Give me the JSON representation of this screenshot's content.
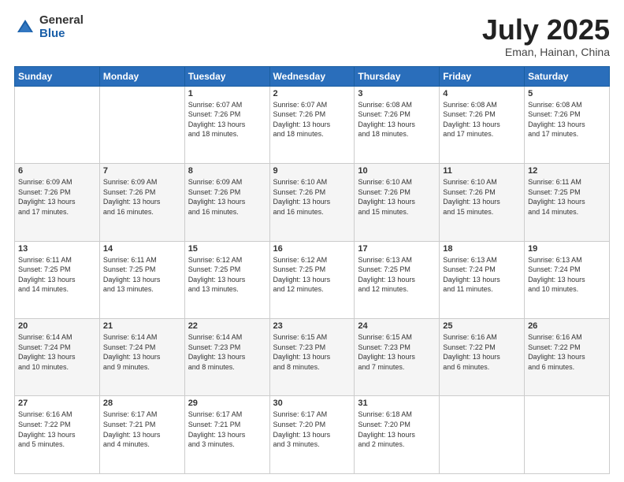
{
  "header": {
    "logo_general": "General",
    "logo_blue": "Blue",
    "title": "July 2025",
    "subtitle": "Eman, Hainan, China"
  },
  "weekdays": [
    "Sunday",
    "Monday",
    "Tuesday",
    "Wednesday",
    "Thursday",
    "Friday",
    "Saturday"
  ],
  "weeks": [
    [
      {
        "day": "",
        "info": ""
      },
      {
        "day": "",
        "info": ""
      },
      {
        "day": "1",
        "info": "Sunrise: 6:07 AM\nSunset: 7:26 PM\nDaylight: 13 hours\nand 18 minutes."
      },
      {
        "day": "2",
        "info": "Sunrise: 6:07 AM\nSunset: 7:26 PM\nDaylight: 13 hours\nand 18 minutes."
      },
      {
        "day": "3",
        "info": "Sunrise: 6:08 AM\nSunset: 7:26 PM\nDaylight: 13 hours\nand 18 minutes."
      },
      {
        "day": "4",
        "info": "Sunrise: 6:08 AM\nSunset: 7:26 PM\nDaylight: 13 hours\nand 17 minutes."
      },
      {
        "day": "5",
        "info": "Sunrise: 6:08 AM\nSunset: 7:26 PM\nDaylight: 13 hours\nand 17 minutes."
      }
    ],
    [
      {
        "day": "6",
        "info": "Sunrise: 6:09 AM\nSunset: 7:26 PM\nDaylight: 13 hours\nand 17 minutes."
      },
      {
        "day": "7",
        "info": "Sunrise: 6:09 AM\nSunset: 7:26 PM\nDaylight: 13 hours\nand 16 minutes."
      },
      {
        "day": "8",
        "info": "Sunrise: 6:09 AM\nSunset: 7:26 PM\nDaylight: 13 hours\nand 16 minutes."
      },
      {
        "day": "9",
        "info": "Sunrise: 6:10 AM\nSunset: 7:26 PM\nDaylight: 13 hours\nand 16 minutes."
      },
      {
        "day": "10",
        "info": "Sunrise: 6:10 AM\nSunset: 7:26 PM\nDaylight: 13 hours\nand 15 minutes."
      },
      {
        "day": "11",
        "info": "Sunrise: 6:10 AM\nSunset: 7:26 PM\nDaylight: 13 hours\nand 15 minutes."
      },
      {
        "day": "12",
        "info": "Sunrise: 6:11 AM\nSunset: 7:25 PM\nDaylight: 13 hours\nand 14 minutes."
      }
    ],
    [
      {
        "day": "13",
        "info": "Sunrise: 6:11 AM\nSunset: 7:25 PM\nDaylight: 13 hours\nand 14 minutes."
      },
      {
        "day": "14",
        "info": "Sunrise: 6:11 AM\nSunset: 7:25 PM\nDaylight: 13 hours\nand 13 minutes."
      },
      {
        "day": "15",
        "info": "Sunrise: 6:12 AM\nSunset: 7:25 PM\nDaylight: 13 hours\nand 13 minutes."
      },
      {
        "day": "16",
        "info": "Sunrise: 6:12 AM\nSunset: 7:25 PM\nDaylight: 13 hours\nand 12 minutes."
      },
      {
        "day": "17",
        "info": "Sunrise: 6:13 AM\nSunset: 7:25 PM\nDaylight: 13 hours\nand 12 minutes."
      },
      {
        "day": "18",
        "info": "Sunrise: 6:13 AM\nSunset: 7:24 PM\nDaylight: 13 hours\nand 11 minutes."
      },
      {
        "day": "19",
        "info": "Sunrise: 6:13 AM\nSunset: 7:24 PM\nDaylight: 13 hours\nand 10 minutes."
      }
    ],
    [
      {
        "day": "20",
        "info": "Sunrise: 6:14 AM\nSunset: 7:24 PM\nDaylight: 13 hours\nand 10 minutes."
      },
      {
        "day": "21",
        "info": "Sunrise: 6:14 AM\nSunset: 7:24 PM\nDaylight: 13 hours\nand 9 minutes."
      },
      {
        "day": "22",
        "info": "Sunrise: 6:14 AM\nSunset: 7:23 PM\nDaylight: 13 hours\nand 8 minutes."
      },
      {
        "day": "23",
        "info": "Sunrise: 6:15 AM\nSunset: 7:23 PM\nDaylight: 13 hours\nand 8 minutes."
      },
      {
        "day": "24",
        "info": "Sunrise: 6:15 AM\nSunset: 7:23 PM\nDaylight: 13 hours\nand 7 minutes."
      },
      {
        "day": "25",
        "info": "Sunrise: 6:16 AM\nSunset: 7:22 PM\nDaylight: 13 hours\nand 6 minutes."
      },
      {
        "day": "26",
        "info": "Sunrise: 6:16 AM\nSunset: 7:22 PM\nDaylight: 13 hours\nand 6 minutes."
      }
    ],
    [
      {
        "day": "27",
        "info": "Sunrise: 6:16 AM\nSunset: 7:22 PM\nDaylight: 13 hours\nand 5 minutes."
      },
      {
        "day": "28",
        "info": "Sunrise: 6:17 AM\nSunset: 7:21 PM\nDaylight: 13 hours\nand 4 minutes."
      },
      {
        "day": "29",
        "info": "Sunrise: 6:17 AM\nSunset: 7:21 PM\nDaylight: 13 hours\nand 3 minutes."
      },
      {
        "day": "30",
        "info": "Sunrise: 6:17 AM\nSunset: 7:20 PM\nDaylight: 13 hours\nand 3 minutes."
      },
      {
        "day": "31",
        "info": "Sunrise: 6:18 AM\nSunset: 7:20 PM\nDaylight: 13 hours\nand 2 minutes."
      },
      {
        "day": "",
        "info": ""
      },
      {
        "day": "",
        "info": ""
      }
    ]
  ]
}
